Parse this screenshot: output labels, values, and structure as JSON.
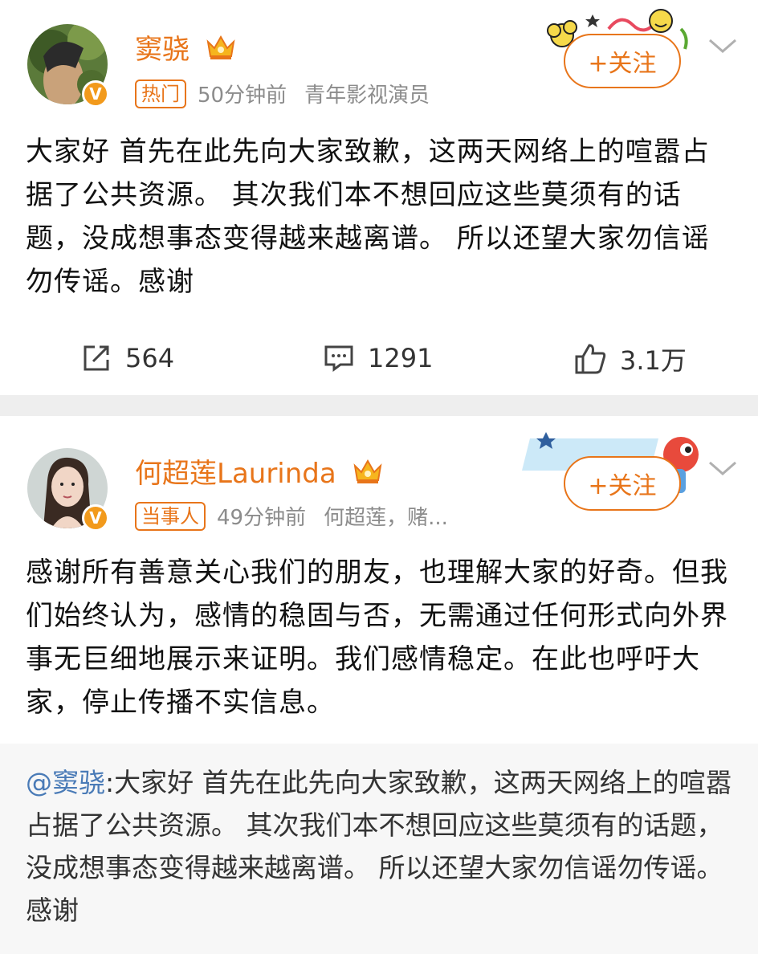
{
  "posts": [
    {
      "author": "窦骁",
      "tag": "热门",
      "time": "50分钟前",
      "description": "青年影视演员",
      "follow_label": "+关注",
      "content": "大家好 首先在此先向大家致歉，这两天网络上的喧嚣占据了公共资源。 其次我们本不想回应这些莫须有的话题，没成想事态变得越来越离谱。 所以还望大家勿信谣勿传谣。感谢",
      "reposts": "564",
      "comments": "1291",
      "likes": "3.1万"
    },
    {
      "author": "何超莲Laurinda",
      "tag": "当事人",
      "time": "49分钟前",
      "description": "何超莲，赌...",
      "follow_label": "+关注",
      "content": "感谢所有善意关心我们的朋友，也理解大家的好奇。但我们始终认为，感情的稳固与否，无需通过任何形式向外界事无巨细地展示来证明。我们感情稳定。在此也呼吁大家，停止传播不实信息。",
      "quote_mention": "@窦骁",
      "quote_text": ":大家好 首先在此先向大家致歉，这两天网络上的喧嚣占据了公共资源。 其次我们本不想回应这些莫须有的话题，没成想事态变得越来越离谱。 所以还望大家勿信谣勿传谣。感谢"
    }
  ],
  "icons": {
    "verified": "v-badge-icon",
    "crown": "crown-icon",
    "repost": "repost-icon",
    "comment": "comment-icon",
    "like": "thumbs-up-icon",
    "more": "chevron-down-icon"
  },
  "colors": {
    "accent": "#e8751a",
    "mention": "#4a7bb7",
    "divider": "#eeeeee",
    "quote_bg": "#f7f7f7"
  }
}
